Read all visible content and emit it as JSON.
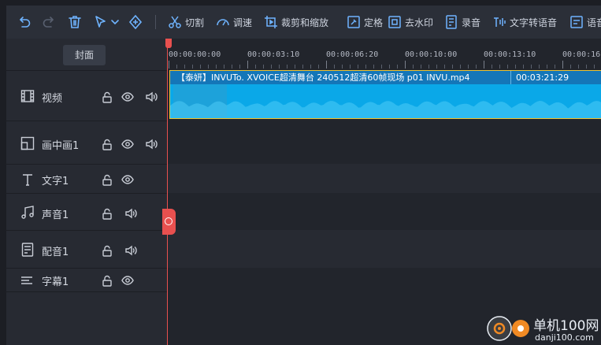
{
  "toolbar": {
    "icons": [
      "undo-icon",
      "redo-icon",
      "delete-icon",
      "select-cursor-icon",
      "chevron-down-icon",
      "add-marker-icon"
    ],
    "tools": [
      {
        "label": "切割",
        "icon": "scissors-icon"
      },
      {
        "label": "调速",
        "icon": "speed-gauge-icon"
      },
      {
        "label": "裁剪和缩放",
        "icon": "crop-zoom-icon"
      },
      {
        "label": "定格",
        "icon": "freeze-frame-icon"
      },
      {
        "label": "去水印",
        "icon": "remove-watermark-icon"
      },
      {
        "label": "录音",
        "icon": "record-audio-icon"
      },
      {
        "label": "文字转语音",
        "icon": "text-to-speech-icon"
      },
      {
        "label": "语音",
        "icon": "speech-icon"
      }
    ]
  },
  "tracks": {
    "cover_label": "封面",
    "rows": [
      {
        "label": "视频",
        "icon": "film-icon",
        "controls": [
          "lock-icon",
          "eye-icon",
          "speaker-icon"
        ]
      },
      {
        "label": "画中画1",
        "icon": "picture-in-picture-icon",
        "controls": [
          "lock-icon",
          "eye-icon",
          "speaker-icon"
        ]
      },
      {
        "label": "文字1",
        "icon": "text-t-icon",
        "controls": [
          "lock-icon",
          "eye-icon"
        ]
      },
      {
        "label": "声音1",
        "icon": "music-note-icon",
        "controls": [
          "lock-icon",
          "speaker-icon"
        ]
      },
      {
        "label": "配音1",
        "icon": "dubbing-icon",
        "controls": [
          "lock-icon",
          "speaker-icon"
        ]
      },
      {
        "label": "字幕1",
        "icon": "subtitle-icon",
        "controls": [
          "lock-icon",
          "eye-icon"
        ]
      }
    ]
  },
  "timeline": {
    "ticks": [
      "00:00:00:00",
      "00:00:03:10",
      "00:00:06:20",
      "00:00:10:00",
      "00:00:13:10",
      "00:00:16:2"
    ],
    "clip": {
      "title": "【泰妍】INVUTo. XVOICE超清舞台 240512超清60帧现场 p01 INVU.mp4",
      "duration": "00:03:21:29"
    }
  },
  "watermark": {
    "text": "单机100网",
    "sub": "danji100.com"
  },
  "colors": {
    "clip": "#0aa8e8",
    "clip_header": "#1476b8",
    "clip_border": "#f0c330",
    "playhead": "#e8504f",
    "panel": "#272a32",
    "toolbar": "#2b2f38"
  }
}
